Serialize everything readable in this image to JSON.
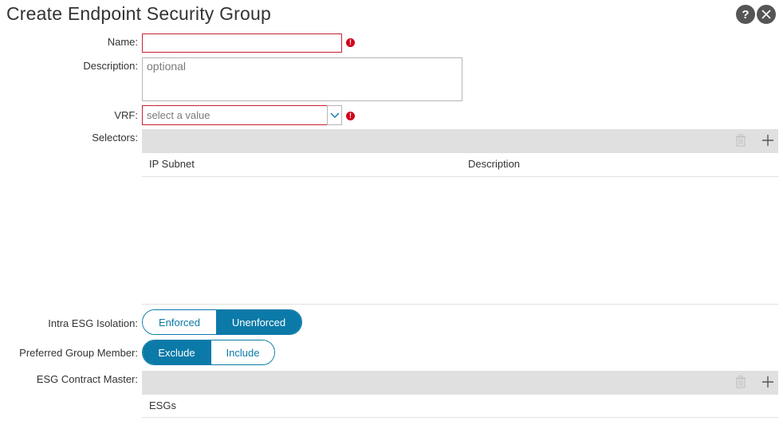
{
  "header": {
    "title": "Create Endpoint Security Group",
    "help_icon": "?"
  },
  "form": {
    "name": {
      "label": "Name:",
      "value": ""
    },
    "description": {
      "label": "Description:",
      "placeholder": "optional"
    },
    "vrf": {
      "label": "VRF:",
      "placeholder": "select a value"
    },
    "error_icon": "!",
    "selectors": {
      "label": "Selectors:",
      "columns": [
        "IP Subnet",
        "Description"
      ]
    },
    "intra_esg_isolation": {
      "label": "Intra ESG Isolation:",
      "options": [
        "Enforced",
        "Unenforced"
      ],
      "selected": "Unenforced"
    },
    "preferred_group_member": {
      "label": "Preferred Group Member:",
      "options": [
        "Exclude",
        "Include"
      ],
      "selected": "Exclude"
    },
    "esg_contract_master": {
      "label": "ESG Contract Master:",
      "columns": [
        "ESGs"
      ]
    }
  },
  "colors": {
    "accent": "#0b7aa8",
    "error": "#d0021b",
    "toolbar": "#e0e0e0"
  }
}
